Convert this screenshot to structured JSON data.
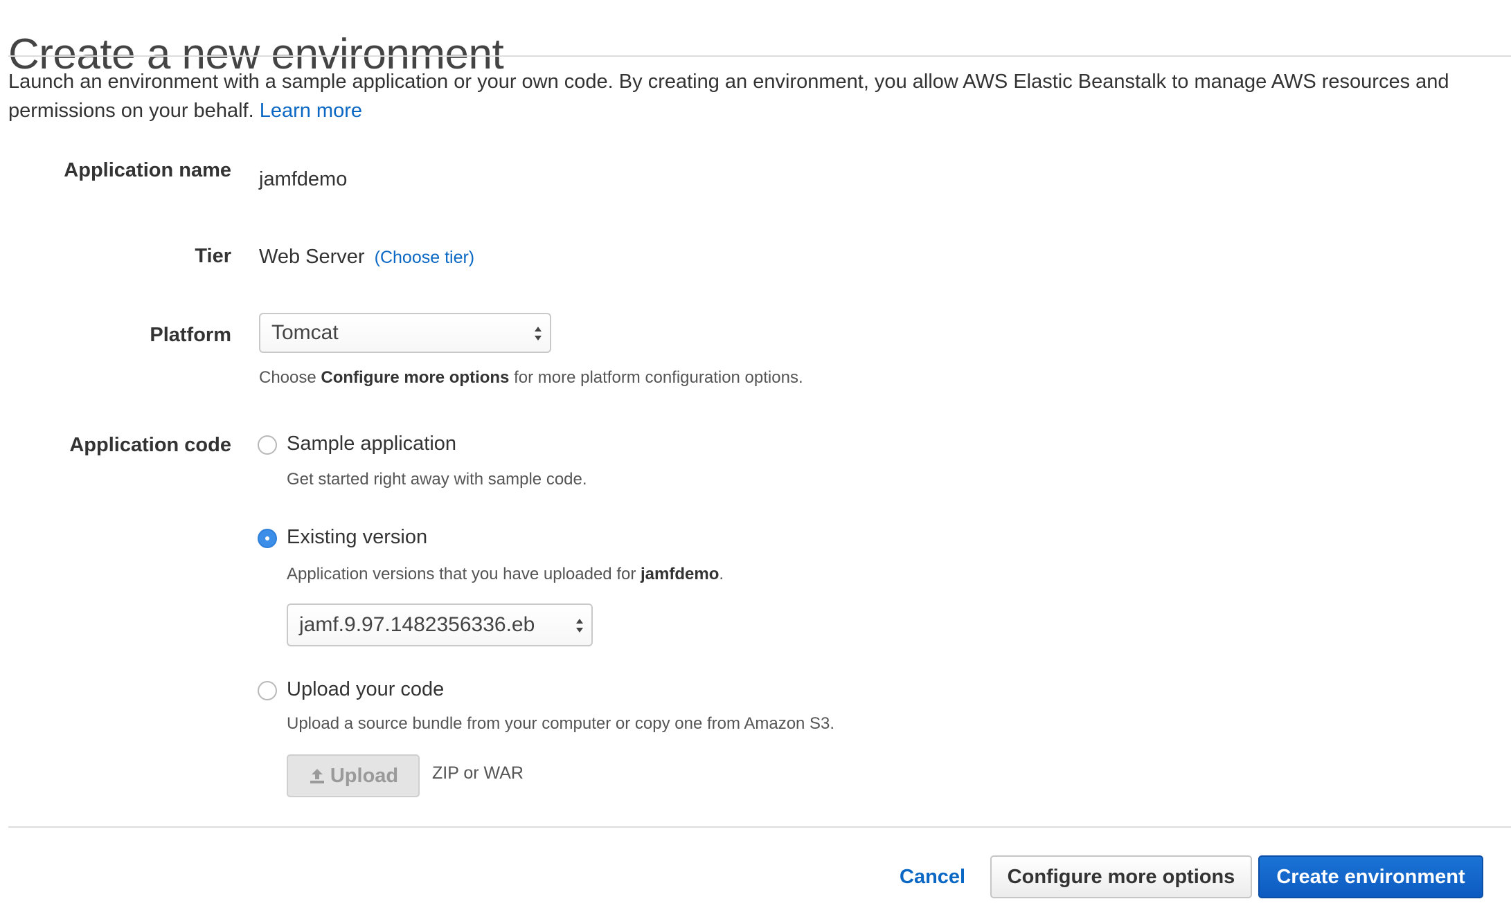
{
  "page": {
    "title": "Create a new environment",
    "intro_text": "Launch an environment with a sample application or your own code. By creating an environment, you allow AWS Elastic Beanstalk to manage AWS resources and permissions on your behalf.",
    "learn_more": "Learn more"
  },
  "form": {
    "application_name": {
      "label": "Application name",
      "value": "jamfdemo"
    },
    "tier": {
      "label": "Tier",
      "value": "Web Server",
      "choose_link": "(Choose tier)"
    },
    "platform": {
      "label": "Platform",
      "selected": "Tomcat",
      "help_prefix": "Choose",
      "help_bold": "Configure more options",
      "help_suffix": "for more platform configuration options."
    },
    "application_code": {
      "label": "Application code",
      "sample": {
        "label": "Sample application",
        "help": "Get started right away with sample code.",
        "checked": false
      },
      "existing": {
        "label": "Existing version",
        "help_prefix": "Application versions that you have uploaded for",
        "help_bold": "jamfdemo",
        "help_suffix": ".",
        "selected_version": "jamf.9.97.1482356336.eb",
        "checked": true
      },
      "upload": {
        "label": "Upload your code",
        "help": "Upload a source bundle from your computer or copy one from Amazon S3.",
        "button_label": "Upload",
        "file_types": "ZIP or WAR",
        "checked": false
      }
    }
  },
  "footer": {
    "cancel_label": "Cancel",
    "configure_label": "Configure more options",
    "create_label": "Create environment"
  },
  "colors": {
    "link": "#0a68c4",
    "primary_button": "#1166cc",
    "radio_checked": "#3d8ee8"
  },
  "icons": {
    "upload": "upload-icon",
    "select_arrows": "select-arrows-icon"
  }
}
